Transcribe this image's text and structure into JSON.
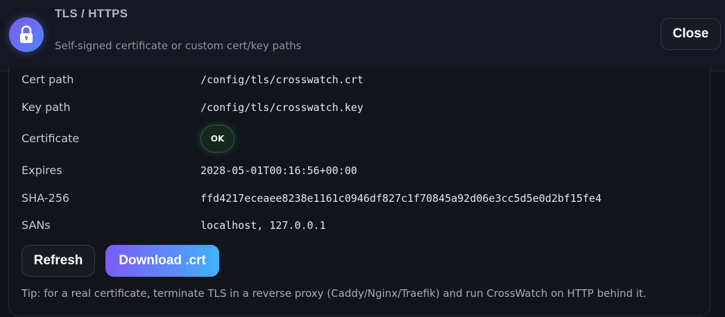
{
  "header": {
    "title": "TLS / HTTPS",
    "subtitle": "Self-signed certificate or custom cert/key paths",
    "icon": "lock-icon",
    "close_label": "Close"
  },
  "details": [
    {
      "label": "Cert path",
      "value": "/config/tls/crosswatch.crt"
    },
    {
      "label": "Key path",
      "value": "/config/tls/crosswatch.key"
    },
    {
      "label": "Certificate",
      "value": "OK"
    },
    {
      "label": "Expires",
      "value": "2028-05-01T00:16:56+00:00"
    },
    {
      "label": "SHA-256",
      "value": "ffd4217eceaee8238e1161c0946df827c1f70845a92d06e3cc5d5e0d2bf15fe4"
    },
    {
      "label": "SANs",
      "value": "localhost, 127.0.0.1"
    }
  ],
  "actions": {
    "refresh_label": "Refresh",
    "download_label": "Download .crt"
  },
  "tip": "Tip: for a real certificate, terminate TLS in a reverse proxy (Caddy/Nginx/Traefik) and run CrossWatch on HTTP behind it.",
  "colors": {
    "accent_start": "#7b5cf6",
    "accent_end": "#3fb3f6",
    "status_ok": "#2c5a40",
    "background": "#0f1117"
  }
}
